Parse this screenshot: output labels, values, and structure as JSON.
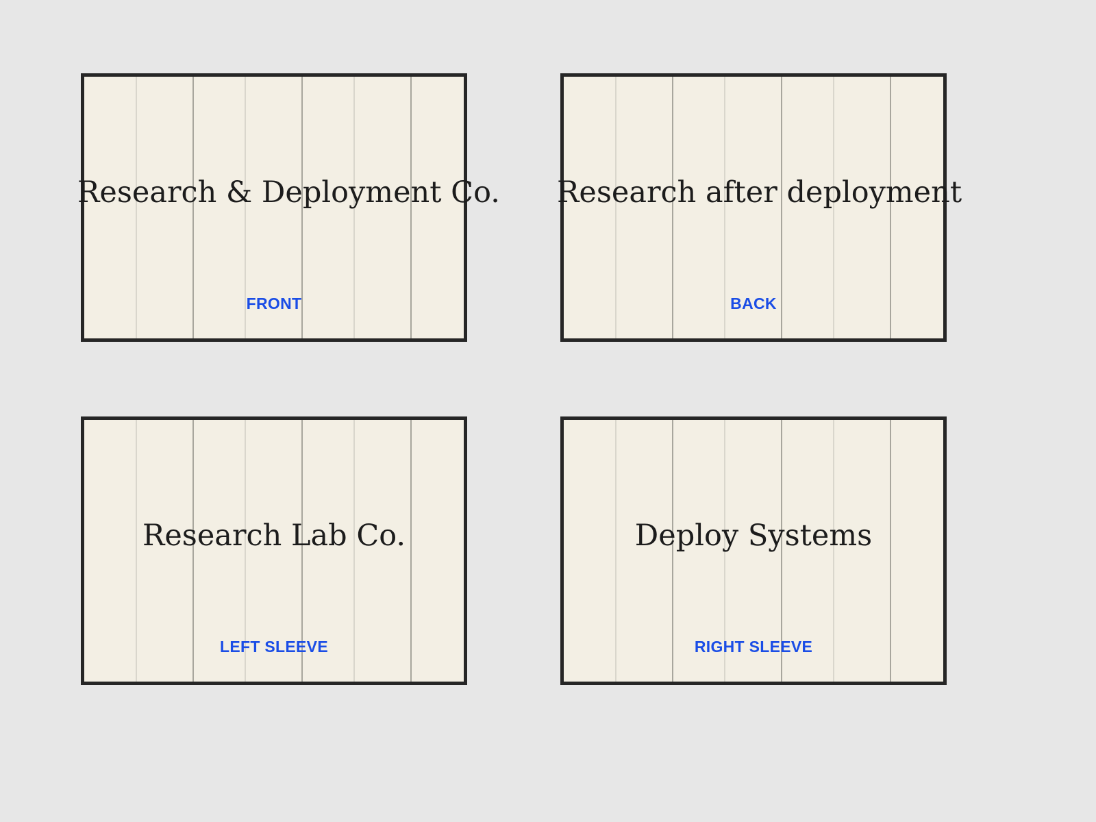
{
  "panels": {
    "front": {
      "text": "Research & Deployment Co.",
      "label": "FRONT"
    },
    "back": {
      "text": "Research after deployment",
      "label": "BACK"
    },
    "left_sleeve": {
      "text": "Research Lab Co.",
      "label": "LEFT SLEEVE"
    },
    "right_sleeve": {
      "text": "Deploy Systems",
      "label": "RIGHT SLEEVE"
    }
  },
  "colors": {
    "background": "#e7e7e7",
    "panel_fill": "#f3efe4",
    "panel_border": "#262626",
    "text": "#1c1c1c",
    "label": "#1a4de6"
  }
}
